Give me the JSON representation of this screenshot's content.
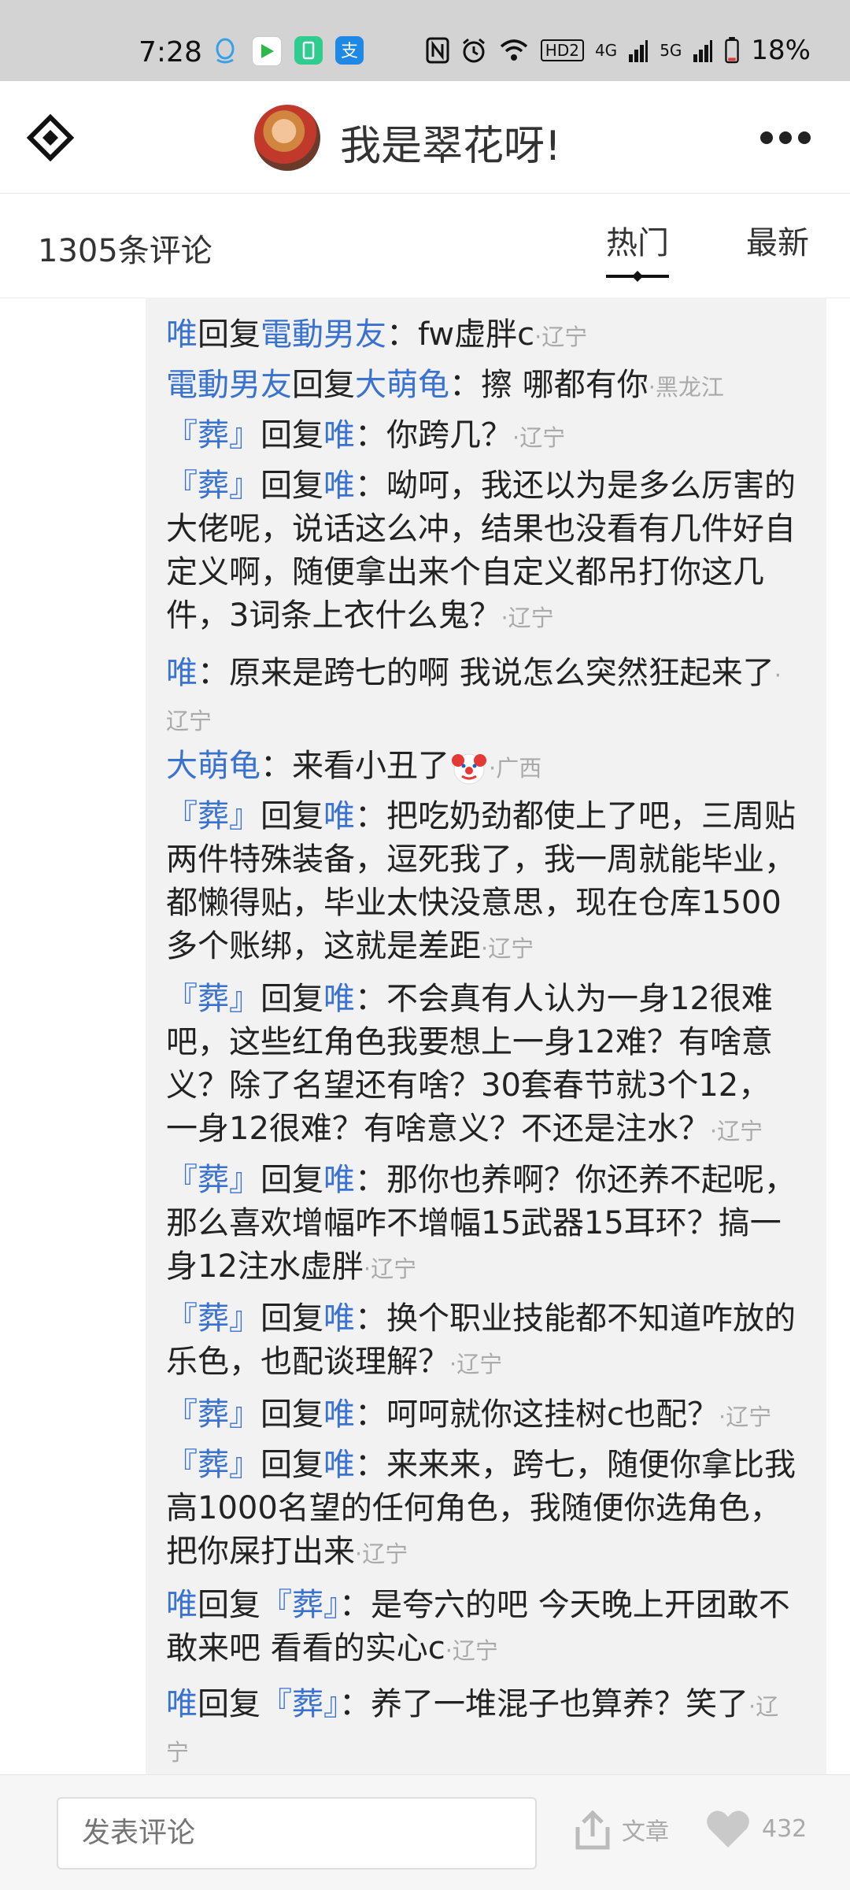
{
  "status_bar": {
    "time": "7:28",
    "network_labels": [
      "HD2",
      "4G",
      "5G"
    ],
    "battery": "18%"
  },
  "header": {
    "title": "我是翠花呀!",
    "logo_icon": "diamond-logo-icon",
    "more_icon": "more-horizontal-icon"
  },
  "comments_bar": {
    "count": "1305条评论",
    "tabs": [
      "热门",
      "最新"
    ],
    "active_tab": "热门"
  },
  "replies": [
    {
      "from": "唯",
      "reply_word": "回复",
      "to": "電動男友",
      "colon": "：",
      "text": "fw虚胖c",
      "location": "·辽宁"
    },
    {
      "from": "電動男友",
      "reply_word": "回复",
      "to": "大萌龟",
      "colon": "：",
      "text": "擦  哪都有你",
      "location": "·黑龙江"
    },
    {
      "from": "『葬』",
      "reply_word": "回复",
      "to": "唯",
      "colon": "：",
      "text": "你跨几？",
      "location": "·辽宁"
    },
    {
      "from": "『葬』",
      "reply_word": "回复",
      "to": "唯",
      "colon": "：",
      "text": "呦呵，我还以为是多么厉害的大佬呢，说话这么冲，结果也没看有几件好自定义啊，随便拿出来个自定义都吊打你这几件，3词条上衣什么鬼？",
      "location": "·辽宁"
    },
    {
      "from": "唯",
      "reply_word": "",
      "to": "",
      "colon": "：",
      "text": "原来是跨七的啊  我说怎么突然狂起来了",
      "location": "·辽宁"
    },
    {
      "from": "大萌龟",
      "reply_word": "",
      "to": "",
      "colon": "：",
      "text": "来看小丑了",
      "emoji": "clown-face-emoji",
      "location": "·广西"
    },
    {
      "from": "『葬』",
      "reply_word": "回复",
      "to": "唯",
      "colon": "：",
      "text": "把吃奶劲都使上了吧，三周贴两件特殊装备，逗死我了，我一周就能毕业，都懒得贴，毕业太快没意思，现在仓库1500多个账绑，这就是差距",
      "location": "·辽宁"
    },
    {
      "from": "『葬』",
      "reply_word": "回复",
      "to": "唯",
      "colon": "：",
      "text": "不会真有人认为一身12很难吧，这些红角色我要想上一身12难？有啥意义？除了名望还有啥？30套春节就3个12，一身12很难？有啥意义？不还是注水？",
      "location": "·辽宁"
    },
    {
      "from": "『葬』",
      "reply_word": "回复",
      "to": "唯",
      "colon": "：",
      "text": "那你也养啊？你还养不起呢，那么喜欢增幅咋不增幅15武器15耳环？搞一身12注水虚胖",
      "location": "·辽宁"
    },
    {
      "from": "『葬』",
      "reply_word": "回复",
      "to": "唯",
      "colon": "：",
      "text": "换个职业技能都不知道咋放的乐色，也配谈理解？",
      "location": "·辽宁"
    },
    {
      "from": "『葬』",
      "reply_word": "回复",
      "to": "唯",
      "colon": "：",
      "text": "呵呵就你这挂树c也配？",
      "location": "·辽宁"
    },
    {
      "from": "『葬』",
      "reply_word": "回复",
      "to": "唯",
      "colon": "：",
      "text": "来来来，跨七，随便你拿比我高1000名望的任何角色，我随便你选角色，把你屎打出来",
      "location": "·辽宁"
    },
    {
      "from": "唯",
      "reply_word": "回复",
      "to": "『葬』",
      "colon": "：",
      "text": "是夸六的吧 今天晚上开团敢不敢来吧  看看的实心c",
      "location": "·辽宁"
    },
    {
      "from": "唯",
      "reply_word": "回复",
      "to": "『葬』",
      "colon": "：",
      "text": "养了一堆混子也算养？笑了",
      "location": "·辽宁"
    }
  ],
  "bottom_bar": {
    "input_placeholder": "发表评论",
    "article_label": "文章",
    "like_count": "432"
  },
  "colors": {
    "username_blue": "#3a72d0",
    "location_gray": "#aaaaaa",
    "replies_bg": "#f2f2f2",
    "status_bar_bg": "#d3d3d3"
  }
}
